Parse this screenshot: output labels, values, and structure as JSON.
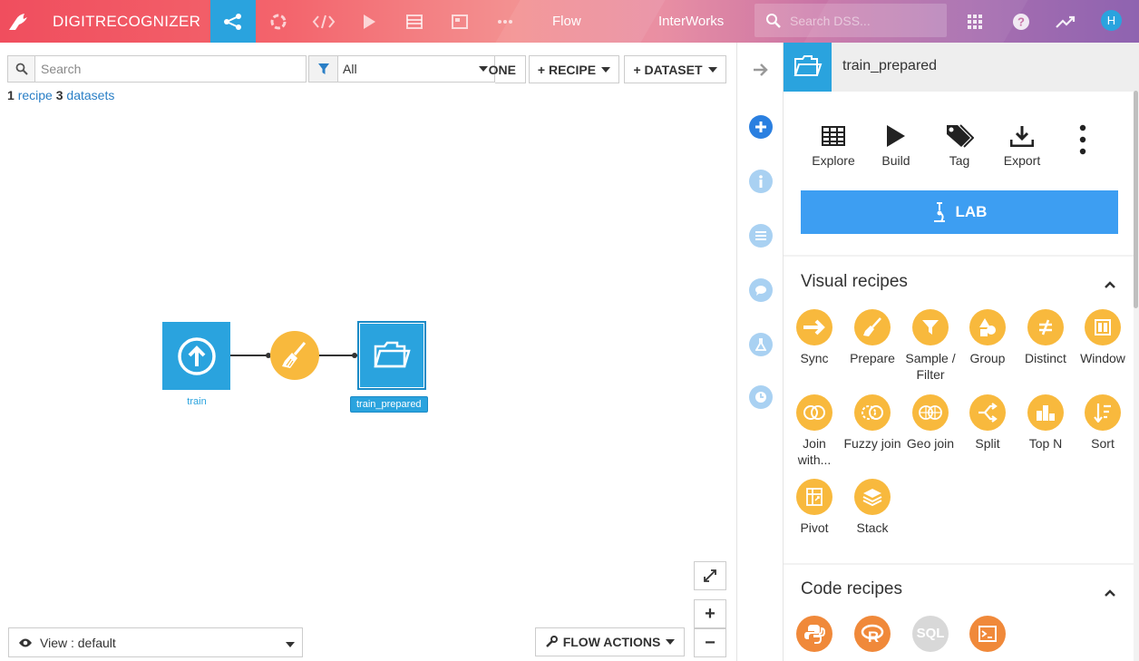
{
  "topbar": {
    "project_name": "DIGITRECOGNIZER",
    "flow_label": "Flow",
    "org_label": "InterWorks",
    "search_placeholder": "Search DSS...",
    "avatar_initial": "H"
  },
  "flow": {
    "search_placeholder": "Search",
    "filter_value": "All",
    "zone_button": "ONE",
    "recipe_button": "+ RECIPE",
    "dataset_button": "+ DATASET",
    "counts": {
      "recipes_num": "1",
      "recipes_label": "recipe",
      "datasets_num": "3",
      "datasets_label": "datasets"
    },
    "nodes": {
      "train": "train",
      "train_prepared": "train_prepared"
    },
    "view_label": "View : default",
    "flow_actions": "FLOW ACTIONS",
    "zoom_in": "+",
    "zoom_out": "−"
  },
  "panel": {
    "title": "train_prepared",
    "actions": [
      "Explore",
      "Build",
      "Tag",
      "Export"
    ],
    "lab_label": "LAB",
    "visual_title": "Visual recipes",
    "visual_recipes": [
      "Sync",
      "Prepare",
      "Sample / Filter",
      "Group",
      "Distinct",
      "Window",
      "Join with...",
      "Fuzzy join",
      "Geo join",
      "Split",
      "Top N",
      "Sort",
      "Pivot",
      "Stack"
    ],
    "code_title": "Code recipes",
    "sql_label": "SQL"
  },
  "colors": {
    "accent": "#2aa3de",
    "lab": "#3d9ef2",
    "visual_recipe": "#f8b93d",
    "code_recipe": "#f0893a"
  }
}
